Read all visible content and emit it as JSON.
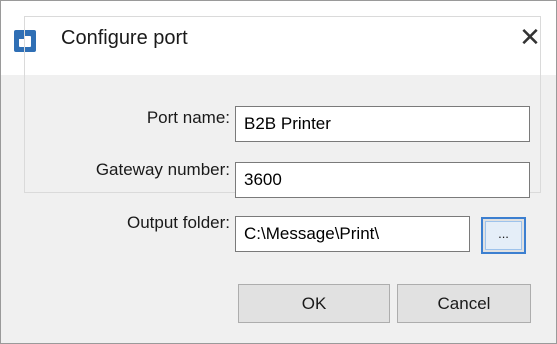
{
  "window": {
    "title": "Configure port",
    "close_symbol": "✕",
    "icon": "app-window-icon"
  },
  "form": {
    "port_name": {
      "label": "Port name:",
      "value": "B2B Printer"
    },
    "gateway_number": {
      "label": "Gateway number:",
      "value": "3600"
    },
    "output_folder": {
      "label": "Output folder:",
      "value": "C:\\Message\\Print\\"
    },
    "browse_label": "..."
  },
  "buttons": {
    "ok": "OK",
    "cancel": "Cancel"
  },
  "colors": {
    "accent": "#3c7fd0",
    "icon": "#2f6fb5"
  }
}
